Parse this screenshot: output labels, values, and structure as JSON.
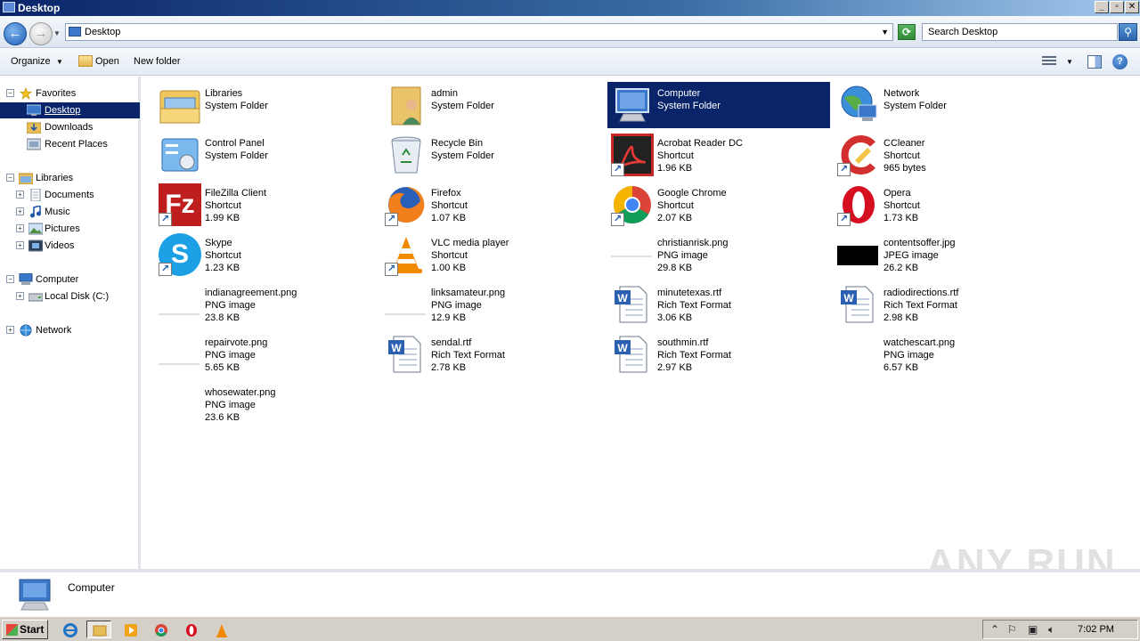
{
  "window": {
    "title": "Desktop"
  },
  "address": {
    "location": "Desktop",
    "search_placeholder": "Search Desktop"
  },
  "toolbar": {
    "organize": "Organize",
    "open": "Open",
    "new_folder": "New folder"
  },
  "nav": {
    "favorites": "Favorites",
    "desktop": "Desktop",
    "downloads": "Downloads",
    "recent_places": "Recent Places",
    "libraries": "Libraries",
    "documents": "Documents",
    "music": "Music",
    "pictures": "Pictures",
    "videos": "Videos",
    "computer": "Computer",
    "local_disk": "Local Disk (C:)",
    "network": "Network"
  },
  "items": [
    {
      "name": "Libraries",
      "type": "System Folder",
      "size": ""
    },
    {
      "name": "admin",
      "type": "System Folder",
      "size": ""
    },
    {
      "name": "Computer",
      "type": "System Folder",
      "size": ""
    },
    {
      "name": "Network",
      "type": "System Folder",
      "size": ""
    },
    {
      "name": "Control Panel",
      "type": "System Folder",
      "size": ""
    },
    {
      "name": "Recycle Bin",
      "type": "System Folder",
      "size": ""
    },
    {
      "name": "Acrobat Reader DC",
      "type": "Shortcut",
      "size": "1.96 KB"
    },
    {
      "name": "CCleaner",
      "type": "Shortcut",
      "size": "965 bytes"
    },
    {
      "name": "FileZilla Client",
      "type": "Shortcut",
      "size": "1.99 KB"
    },
    {
      "name": "Firefox",
      "type": "Shortcut",
      "size": "1.07 KB"
    },
    {
      "name": "Google Chrome",
      "type": "Shortcut",
      "size": "2.07 KB"
    },
    {
      "name": "Opera",
      "type": "Shortcut",
      "size": "1.73 KB"
    },
    {
      "name": "Skype",
      "type": "Shortcut",
      "size": "1.23 KB"
    },
    {
      "name": "VLC media player",
      "type": "Shortcut",
      "size": "1.00 KB"
    },
    {
      "name": "christianrisk.png",
      "type": "PNG image",
      "size": "29.8 KB"
    },
    {
      "name": "contentsoffer.jpg",
      "type": "JPEG image",
      "size": "26.2 KB"
    },
    {
      "name": "indianagreement.png",
      "type": "PNG image",
      "size": "23.8 KB"
    },
    {
      "name": "linksamateur.png",
      "type": "PNG image",
      "size": "12.9 KB"
    },
    {
      "name": "minutetexas.rtf",
      "type": "Rich Text Format",
      "size": "3.06 KB"
    },
    {
      "name": "radiodirections.rtf",
      "type": "Rich Text Format",
      "size": "2.98 KB"
    },
    {
      "name": "repairvote.png",
      "type": "PNG image",
      "size": "5.65 KB"
    },
    {
      "name": "sendal.rtf",
      "type": "Rich Text Format",
      "size": "2.78 KB"
    },
    {
      "name": "southmin.rtf",
      "type": "Rich Text Format",
      "size": "2.97 KB"
    },
    {
      "name": "watchescart.png",
      "type": "PNG image",
      "size": "6.57 KB"
    },
    {
      "name": "whosewater.png",
      "type": "PNG image",
      "size": "23.6 KB"
    }
  ],
  "details": {
    "selected_name": "Computer"
  },
  "watermark": "ANY RUN",
  "taskbar": {
    "start": "Start",
    "clock": "7:02 PM"
  },
  "colors": {
    "selection": "#0a246a",
    "title_bar": "#0a246a"
  }
}
